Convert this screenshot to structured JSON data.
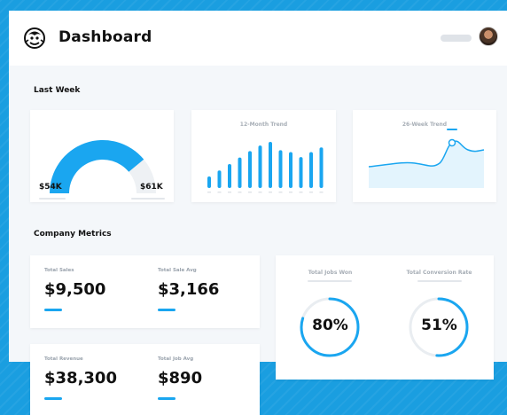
{
  "header": {
    "title": "Dashboard"
  },
  "sections": {
    "last_week": "Last Week",
    "company_metrics": "Company Metrics"
  },
  "gauge": {
    "left_value": "$54K",
    "right_value": "$61K",
    "fill_fraction": 0.78
  },
  "trend12": {
    "title": "12-Month Trend",
    "bars": [
      0.25,
      0.38,
      0.52,
      0.66,
      0.8,
      0.92,
      1.0,
      0.82,
      0.78,
      0.67,
      0.78,
      0.88
    ]
  },
  "trend26": {
    "title": "26-Week Trend"
  },
  "metrics": {
    "total_sales": {
      "label": "Total Sales",
      "value": "$9,500"
    },
    "total_sale_avg": {
      "label": "Total Sale Avg",
      "value": "$3,166"
    },
    "total_revenue": {
      "label": "Total Revenue",
      "value": "$38,300"
    },
    "total_job_avg": {
      "label": "Total Job Avg",
      "value": "$890"
    }
  },
  "rings": {
    "jobs_won": {
      "label": "Total Jobs Won",
      "value": "80%",
      "fraction": 0.8
    },
    "conversion": {
      "label": "Total Conversion Rate",
      "value": "51%",
      "fraction": 0.51
    }
  },
  "colors": {
    "accent": "#1aa6f0",
    "track": "#e9edf1",
    "background_blue": "#1a9ee0"
  }
}
